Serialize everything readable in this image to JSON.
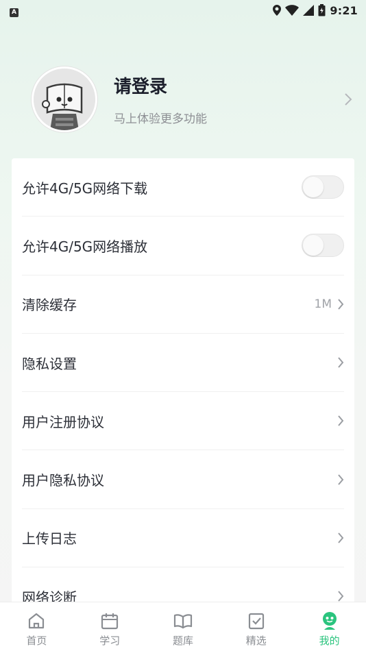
{
  "status_bar": {
    "time": "9:21",
    "badge": "A"
  },
  "profile": {
    "title": "请登录",
    "subtitle": "马上体验更多功能"
  },
  "settings": [
    {
      "label": "允许4G/5G网络下载",
      "type": "toggle",
      "on": false
    },
    {
      "label": "允许4G/5G网络播放",
      "type": "toggle",
      "on": false
    },
    {
      "label": "清除缓存",
      "type": "link",
      "value": "1M"
    },
    {
      "label": "隐私设置",
      "type": "link"
    },
    {
      "label": "用户注册协议",
      "type": "link"
    },
    {
      "label": "用户隐私协议",
      "type": "link"
    },
    {
      "label": "上传日志",
      "type": "link"
    },
    {
      "label": "网络诊断",
      "type": "link"
    }
  ],
  "tabs": [
    {
      "label": "首页",
      "icon": "home-icon"
    },
    {
      "label": "学习",
      "icon": "calendar-icon"
    },
    {
      "label": "题库",
      "icon": "book-icon"
    },
    {
      "label": "精选",
      "icon": "checkbox-icon"
    },
    {
      "label": "我的",
      "icon": "profile-icon",
      "active": true
    }
  ],
  "colors": {
    "accent": "#2bc47e",
    "text": "#2c2f37"
  }
}
